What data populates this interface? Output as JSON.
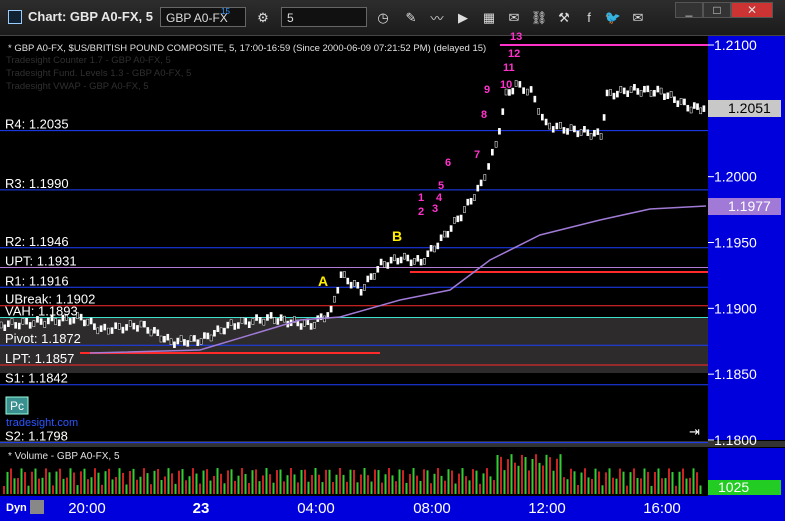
{
  "window": {
    "title": "Chart: GBP A0-FX, 5",
    "symbol": "GBP A0-FX",
    "symbol_superscript": "15",
    "interval": "5"
  },
  "toolbar_icons": [
    "settings-icon",
    "clock-icon",
    "pencil-icon",
    "line-chart-icon",
    "play-icon",
    "ticker-icon",
    "text-icon",
    "link-icon",
    "tools-icon",
    "facebook-icon",
    "twitter-icon",
    "email-icon"
  ],
  "legend": {
    "main": "* GBP A0-FX, $US/BRITISH POUND COMPOSITE, 5, 17:00-16:59 (Since 2000-06-09 07:21:52 PM) (delayed 15)",
    "line2": "Tradesight Counter 1.7 - GBP A0-FX, 5",
    "line3": "Tradesight Fund. Levels 1.3 - GBP A0-FX, 5",
    "line4": "Tradesight VWAP - GBP A0-FX, 5"
  },
  "levels": [
    {
      "label": "R4: 1.2035",
      "value": 1.2035,
      "color": "#1f3fff"
    },
    {
      "label": "R3: 1.1990",
      "value": 1.199,
      "color": "#1f3fff"
    },
    {
      "label": "R2: 1.1946",
      "value": 1.1946,
      "color": "#1f3fff"
    },
    {
      "label": "UPT: 1.1931",
      "value": 1.1931,
      "color": "#b07ad6"
    },
    {
      "label": "R1: 1.1916",
      "value": 1.1916,
      "color": "#1f3fff"
    },
    {
      "label": "UBreak: 1.1902",
      "value": 1.1902,
      "color": "#ff2a2a"
    },
    {
      "label": "VAH: 1.1893",
      "value": 1.1893,
      "color": "#40e0d0"
    },
    {
      "label": "Pivot: 1.1872",
      "value": 1.1872,
      "color": "#1f3fff"
    },
    {
      "label": "LPT: 1.1857",
      "value": 1.1857,
      "color": "#ff2a2a"
    },
    {
      "label": "S1: 1.1842",
      "value": 1.1842,
      "color": "#1f3fff"
    },
    {
      "label": "S2: 1.1798",
      "value": 1.1798,
      "color": "#1f3fff"
    }
  ],
  "price_axis": {
    "ticks": [
      "1.2100",
      "1.2050",
      "1.2000",
      "1.1950",
      "1.1900",
      "1.1850",
      "1.1800"
    ],
    "last_price": "1.2051",
    "vwap_price": "1.1977",
    "volume_value": "1025"
  },
  "time_axis": {
    "labels": [
      "20:00",
      "23",
      "04:00",
      "08:00",
      "12:00",
      "16:00"
    ],
    "dyn_label": "Dyn"
  },
  "annotations": {
    "A": "A",
    "B": "B",
    "counts": [
      "1",
      "2",
      "3",
      "4",
      "5",
      "6",
      "7",
      "8",
      "9",
      "10",
      "11",
      "12",
      "13"
    ]
  },
  "pc_label": "Pc",
  "watermark": "tradesight.com",
  "volume_legend": "* Volume - GBP A0-FX, 5",
  "colors": {
    "background": "#000000",
    "axis_blue": "#0000dd",
    "candle": "#ffffff",
    "vwap": "#a07ad6",
    "count_magenta": "#ff33cc"
  }
}
